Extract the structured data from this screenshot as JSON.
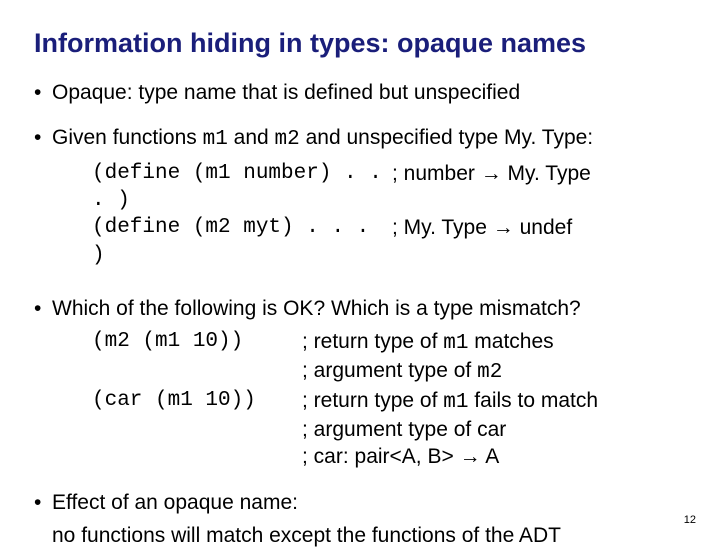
{
  "title": "Information hiding in types: opaque names",
  "bullets": {
    "b1": "Opaque: type name that is defined but unspecified",
    "b2_pre": "Given functions ",
    "b2_m1": "m1",
    "b2_mid1": " and ",
    "b2_m2": "m2",
    "b2_mid2": " and unspecified type My. Type:",
    "b3": "Which of the following is OK?   Which is a type mismatch?",
    "b4_l1": "Effect of an opaque name:",
    "b4_l2": "no functions will match except the functions of the ADT"
  },
  "defs": {
    "r1c": "(define (m1 number) . . . )",
    "r1s_pre": "; number ",
    "r1s_post": " My. Type",
    "r2c": "(define (m2 myt) . . . )",
    "r2s_pre": "; My. Type ",
    "r2s_post": " undef"
  },
  "ex": {
    "e1c": "(m2 (m1 10))",
    "e1s_a": "; return type of ",
    "e1s_m1": "m1",
    "e1s_b": " matches",
    "e2s_a": "; argument type of ",
    "e2s_m2": "m2",
    "e3c": "(car (m1 10))",
    "e3s_a": "; return type of ",
    "e3s_m1": "m1",
    "e3s_b": " fails to match",
    "e4s": "; argument type of car",
    "e5s_a": "; car: pair<A, B> ",
    "e5s_b": " A"
  },
  "arrow": "→",
  "pagenum": "12"
}
